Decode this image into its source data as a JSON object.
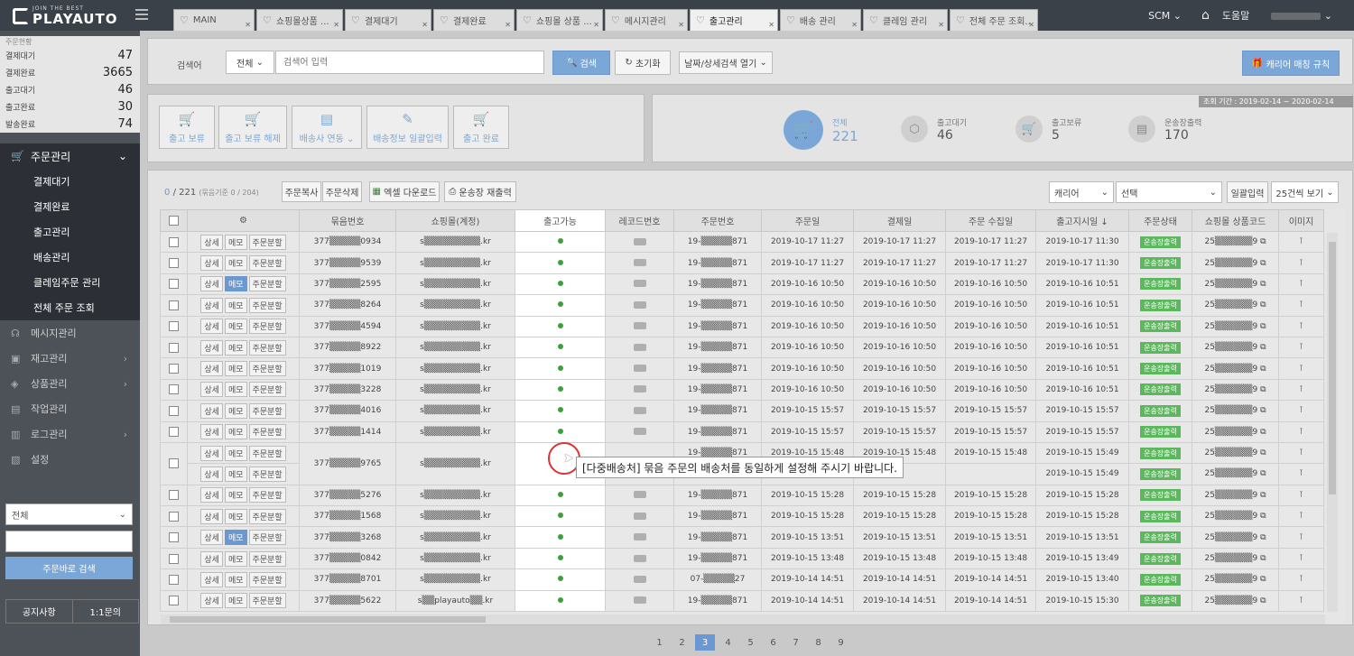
{
  "brand": {
    "tagline": "JOIN THE BEST",
    "name": "PLAYAUTO"
  },
  "tabs": [
    {
      "label": "MAIN",
      "active": false
    },
    {
      "label": "쇼핑몰상품 ...",
      "active": false
    },
    {
      "label": "결제대기",
      "active": false
    },
    {
      "label": "결제완료",
      "active": false
    },
    {
      "label": "쇼핑몰 상품 ...",
      "active": false
    },
    {
      "label": "메시지관리",
      "active": false
    },
    {
      "label": "출고관리",
      "active": true
    },
    {
      "label": "배송 관리",
      "active": false
    },
    {
      "label": "클레임 관리",
      "active": false
    },
    {
      "label": "전체 주문 조회..",
      "active": false
    }
  ],
  "topbar": {
    "scm": "SCM",
    "help": "도움말"
  },
  "sidebar": {
    "stats_caption": "주문현황",
    "stats": [
      {
        "label": "결제대기",
        "value": "47"
      },
      {
        "label": "결제완료",
        "value": "3665"
      },
      {
        "label": "출고대기",
        "value": "46"
      },
      {
        "label": "출고완료",
        "value": "30"
      },
      {
        "label": "발송완료",
        "value": "74"
      }
    ],
    "menu_main": "주문관리",
    "menu_sub": [
      "결제대기",
      "결제완료",
      "출고관리",
      "배송관리",
      "클레임주문 관리",
      "전체 주문 조회"
    ],
    "menu_other": [
      "메시지관리",
      "재고관리",
      "상품관리",
      "작업관리",
      "로그관리",
      "설정"
    ],
    "search_select": "전체",
    "search_button": "주문바로 검색",
    "footer": [
      "공지사항",
      "1:1문의"
    ]
  },
  "search": {
    "label": "검색어",
    "scope": "전체",
    "placeholder": "검색어 입력",
    "search_btn": "검색",
    "reset_btn": "초기화",
    "detail_btn": "날짜/상세검색 열기",
    "carrier_btn": "캐리어 매칭 규칙"
  },
  "actions": [
    "출고 보류",
    "출고 보류 해제",
    "배송사 연동",
    "배송정보 일괄입력",
    "출고 완료"
  ],
  "summary": {
    "period": "조회 기간 : 2019-02-14 ~ 2020-02-14",
    "items": [
      {
        "label": "전체",
        "value": "221"
      },
      {
        "label": "출고대기",
        "value": "46"
      },
      {
        "label": "출고보류",
        "value": "5"
      },
      {
        "label": "운송장출력",
        "value": "170"
      }
    ]
  },
  "toolbar": {
    "count_sel": "0",
    "count_total": "/ 221",
    "count_note": "(묶음기준 0 / 204)",
    "copy": "주문복사",
    "delete": "주문삭제",
    "excel": "엑셀 다운로드",
    "reprint": "운송장 재출력",
    "carrier_sel": "캐리어",
    "choose_sel": "선택",
    "bulk_btn": "일괄입력",
    "per_page": "25건씩 보기"
  },
  "table": {
    "headers": [
      "",
      "⚙",
      "묶음번호",
      "쇼핑몰(계정)",
      "출고가능",
      "레코드번호",
      "주문번호",
      "주문일",
      "결제일",
      "주문 수집일",
      "출고지시일 ↓",
      "주문상태",
      "쇼핑몰 상품코드",
      "이미지"
    ],
    "btn_detail": "상세",
    "btn_memo": "메모",
    "btn_split": "주문분할",
    "status": "운송장출력",
    "rows": [
      {
        "bundle": "377▒▒▒▒▒0934",
        "mall": "s▒▒▒▒▒▒▒▒▒.kr",
        "order": "19-▒▒▒▒▒871",
        "od": "2019-10-17 11:27",
        "pd": "2019-10-17 11:27",
        "cd": "2019-10-17 11:27",
        "sd": "2019-10-17 11:30",
        "code": "25▒▒▒▒▒▒9",
        "memo_on": false,
        "dot": true
      },
      {
        "bundle": "377▒▒▒▒▒9539",
        "mall": "s▒▒▒▒▒▒▒▒▒.kr",
        "order": "19-▒▒▒▒▒871",
        "od": "2019-10-17 11:27",
        "pd": "2019-10-17 11:27",
        "cd": "2019-10-17 11:27",
        "sd": "2019-10-17 11:30",
        "code": "25▒▒▒▒▒▒9",
        "memo_on": false,
        "dot": true
      },
      {
        "bundle": "377▒▒▒▒▒2595",
        "mall": "s▒▒▒▒▒▒▒▒▒.kr",
        "order": "19-▒▒▒▒▒871",
        "od": "2019-10-16 10:50",
        "pd": "2019-10-16 10:50",
        "cd": "2019-10-16 10:50",
        "sd": "2019-10-16 10:51",
        "code": "25▒▒▒▒▒▒9",
        "memo_on": true,
        "dot": true
      },
      {
        "bundle": "377▒▒▒▒▒8264",
        "mall": "s▒▒▒▒▒▒▒▒▒.kr",
        "order": "19-▒▒▒▒▒871",
        "od": "2019-10-16 10:50",
        "pd": "2019-10-16 10:50",
        "cd": "2019-10-16 10:50",
        "sd": "2019-10-16 10:51",
        "code": "25▒▒▒▒▒▒9",
        "memo_on": false,
        "dot": true
      },
      {
        "bundle": "377▒▒▒▒▒4594",
        "mall": "s▒▒▒▒▒▒▒▒▒.kr",
        "order": "19-▒▒▒▒▒871",
        "od": "2019-10-16 10:50",
        "pd": "2019-10-16 10:50",
        "cd": "2019-10-16 10:50",
        "sd": "2019-10-16 10:51",
        "code": "25▒▒▒▒▒▒9",
        "memo_on": false,
        "dot": true
      },
      {
        "bundle": "377▒▒▒▒▒8922",
        "mall": "s▒▒▒▒▒▒▒▒▒.kr",
        "order": "19-▒▒▒▒▒871",
        "od": "2019-10-16 10:50",
        "pd": "2019-10-16 10:50",
        "cd": "2019-10-16 10:50",
        "sd": "2019-10-16 10:51",
        "code": "25▒▒▒▒▒▒9",
        "memo_on": false,
        "dot": true
      },
      {
        "bundle": "377▒▒▒▒▒1019",
        "mall": "s▒▒▒▒▒▒▒▒▒.kr",
        "order": "19-▒▒▒▒▒871",
        "od": "2019-10-16 10:50",
        "pd": "2019-10-16 10:50",
        "cd": "2019-10-16 10:50",
        "sd": "2019-10-16 10:51",
        "code": "25▒▒▒▒▒▒9",
        "memo_on": false,
        "dot": true
      },
      {
        "bundle": "377▒▒▒▒▒3228",
        "mall": "s▒▒▒▒▒▒▒▒▒.kr",
        "order": "19-▒▒▒▒▒871",
        "od": "2019-10-16 10:50",
        "pd": "2019-10-16 10:50",
        "cd": "2019-10-16 10:50",
        "sd": "2019-10-16 10:51",
        "code": "25▒▒▒▒▒▒9",
        "memo_on": false,
        "dot": true
      },
      {
        "bundle": "377▒▒▒▒▒4016",
        "mall": "s▒▒▒▒▒▒▒▒▒.kr",
        "order": "19-▒▒▒▒▒871",
        "od": "2019-10-15 15:57",
        "pd": "2019-10-15 15:57",
        "cd": "2019-10-15 15:57",
        "sd": "2019-10-15 15:57",
        "code": "25▒▒▒▒▒▒9",
        "memo_on": false,
        "dot": true
      },
      {
        "bundle": "377▒▒▒▒▒1414",
        "mall": "s▒▒▒▒▒▒▒▒▒.kr",
        "order": "19-▒▒▒▒▒871",
        "od": "2019-10-15 15:57",
        "pd": "2019-10-15 15:57",
        "cd": "2019-10-15 15:57",
        "sd": "2019-10-15 15:57",
        "code": "25▒▒▒▒▒▒9",
        "memo_on": false,
        "dot": true
      },
      {
        "bundle": "377▒▒▒▒▒9765",
        "mall": "s▒▒▒▒▒▒▒▒▒.kr",
        "order": "19-▒▒▒▒▒871",
        "od": "2019-10-15 15:48",
        "pd": "2019-10-15 15:48",
        "cd": "2019-10-15 15:48",
        "sd": "2019-10-15 15:49",
        "code": "25▒▒▒▒▒▒9",
        "memo_on": false,
        "dot": false
      },
      {
        "bundle": "",
        "mall": "",
        "order": "",
        "od": "",
        "pd": "",
        "cd": "",
        "sd": "2019-10-15 15:49",
        "code": "25▒▒▒▒▒▒9",
        "memo_on": false,
        "dot": false
      },
      {
        "bundle": "377▒▒▒▒▒5276",
        "mall": "s▒▒▒▒▒▒▒▒▒.kr",
        "order": "19-▒▒▒▒▒871",
        "od": "2019-10-15 15:28",
        "pd": "2019-10-15 15:28",
        "cd": "2019-10-15 15:28",
        "sd": "2019-10-15 15:28",
        "code": "25▒▒▒▒▒▒9",
        "memo_on": false,
        "dot": true
      },
      {
        "bundle": "377▒▒▒▒▒1568",
        "mall": "s▒▒▒▒▒▒▒▒▒.kr",
        "order": "19-▒▒▒▒▒871",
        "od": "2019-10-15 15:28",
        "pd": "2019-10-15 15:28",
        "cd": "2019-10-15 15:28",
        "sd": "2019-10-15 15:28",
        "code": "25▒▒▒▒▒▒9",
        "memo_on": false,
        "dot": true
      },
      {
        "bundle": "377▒▒▒▒▒3268",
        "mall": "s▒▒▒▒▒▒▒▒▒.kr",
        "order": "19-▒▒▒▒▒871",
        "od": "2019-10-15 13:51",
        "pd": "2019-10-15 13:51",
        "cd": "2019-10-15 13:51",
        "sd": "2019-10-15 13:51",
        "code": "25▒▒▒▒▒▒9",
        "memo_on": true,
        "dot": true
      },
      {
        "bundle": "377▒▒▒▒▒0842",
        "mall": "s▒▒▒▒▒▒▒▒▒.kr",
        "order": "19-▒▒▒▒▒871",
        "od": "2019-10-15 13:48",
        "pd": "2019-10-15 13:48",
        "cd": "2019-10-15 13:48",
        "sd": "2019-10-15 13:49",
        "code": "25▒▒▒▒▒▒9",
        "memo_on": false,
        "dot": true
      },
      {
        "bundle": "377▒▒▒▒▒8701",
        "mall": "s▒▒▒▒▒▒▒▒▒.kr",
        "order": "07-▒▒▒▒▒27",
        "od": "2019-10-14 14:51",
        "pd": "2019-10-14 14:51",
        "cd": "2019-10-14 14:51",
        "sd": "2019-10-15 13:40",
        "code": "25▒▒▒▒▒▒9",
        "memo_on": false,
        "dot": true
      },
      {
        "bundle": "377▒▒▒▒▒5622",
        "mall": "s▒▒playauto▒▒.kr",
        "order": "19-▒▒▒▒▒871",
        "od": "2019-10-14 14:51",
        "pd": "2019-10-14 14:51",
        "cd": "2019-10-14 14:51",
        "sd": "2019-10-15 15:30",
        "code": "25▒▒▒▒▒▒9",
        "memo_on": false,
        "dot": true
      }
    ]
  },
  "tooltip": "[다중배송처] 묶음 주문의 배송처를 동일하게 설정해 주시기 바랍니다.",
  "pagination": {
    "pages": [
      "1",
      "2",
      "3",
      "4",
      "5",
      "6",
      "7",
      "8",
      "9"
    ],
    "current": "3"
  }
}
